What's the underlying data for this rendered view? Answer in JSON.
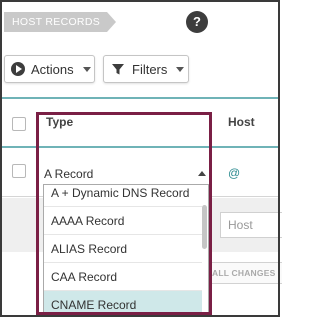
{
  "header": {
    "tag_label": "HOST RECORDS",
    "help_glyph": "?"
  },
  "toolbar": {
    "actions_label": "Actions",
    "filters_label": "Filters"
  },
  "table": {
    "col_type": "Type",
    "col_host": "Host",
    "row1_host": "@",
    "row2_host_placeholder": "Host"
  },
  "record_type_select": {
    "selected": "A Record",
    "options": [
      "A + Dynamic DNS Record",
      "AAAA Record",
      "ALIAS Record",
      "CAA Record",
      "CNAME Record"
    ]
  },
  "footer": {
    "save_changes_partial": "ALL CHANGES"
  },
  "colors": {
    "accent": "#6fb3b7",
    "highlight_border": "#7a1f45",
    "selected_option_bg": "#cfe8e9"
  }
}
